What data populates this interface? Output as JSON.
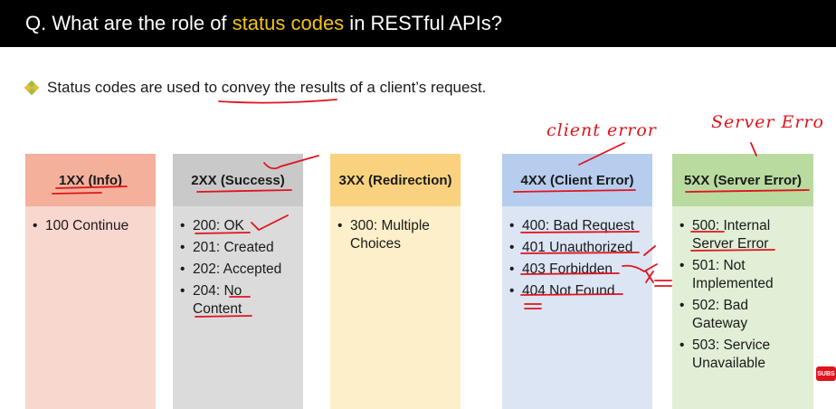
{
  "title": {
    "prefix": "Q. What are the role of ",
    "highlight": "status codes",
    "suffix": " in RESTful APIs?"
  },
  "intro": {
    "text": "Status codes are used to convey the results of a client’s request."
  },
  "annotations": {
    "client": "client error",
    "server": "Server Erro"
  },
  "columns": [
    {
      "header": "1XX (Info)",
      "items": [
        "100 Continue"
      ]
    },
    {
      "header": "2XX (Success)",
      "items": [
        "200: OK",
        "201: Created",
        "202: Accepted",
        "204: No Content"
      ]
    },
    {
      "header": "3XX (Redirection)",
      "items": [
        "300: Multiple Choices"
      ]
    },
    {
      "header": "4XX (Client Error)",
      "items": [
        "400: Bad Request",
        "401 Unauthorized",
        "403 Forbidden",
        "404 Not Found"
      ]
    },
    {
      "header": "5XX (Server Error)",
      "items": [
        "500: Internal Server Error",
        "501: Not Implemented",
        "502: Bad Gateway",
        "503: Service Unavailable"
      ]
    }
  ],
  "badge": "SUBS",
  "colors": {
    "title_highlight": "#f2c31a",
    "ink": "#e0141e",
    "col1_header": "#f4b09a",
    "col1_body": "#f8d7cf",
    "col2_header": "#c9c9c9",
    "col2_body": "#dbdbdb",
    "col3_header": "#fad27f",
    "col3_body": "#fdefc9",
    "col4_header": "#b7cdee",
    "col4_body": "#dbe5f4",
    "col5_header": "#b9dba0",
    "col5_body": "#e1efd6"
  }
}
